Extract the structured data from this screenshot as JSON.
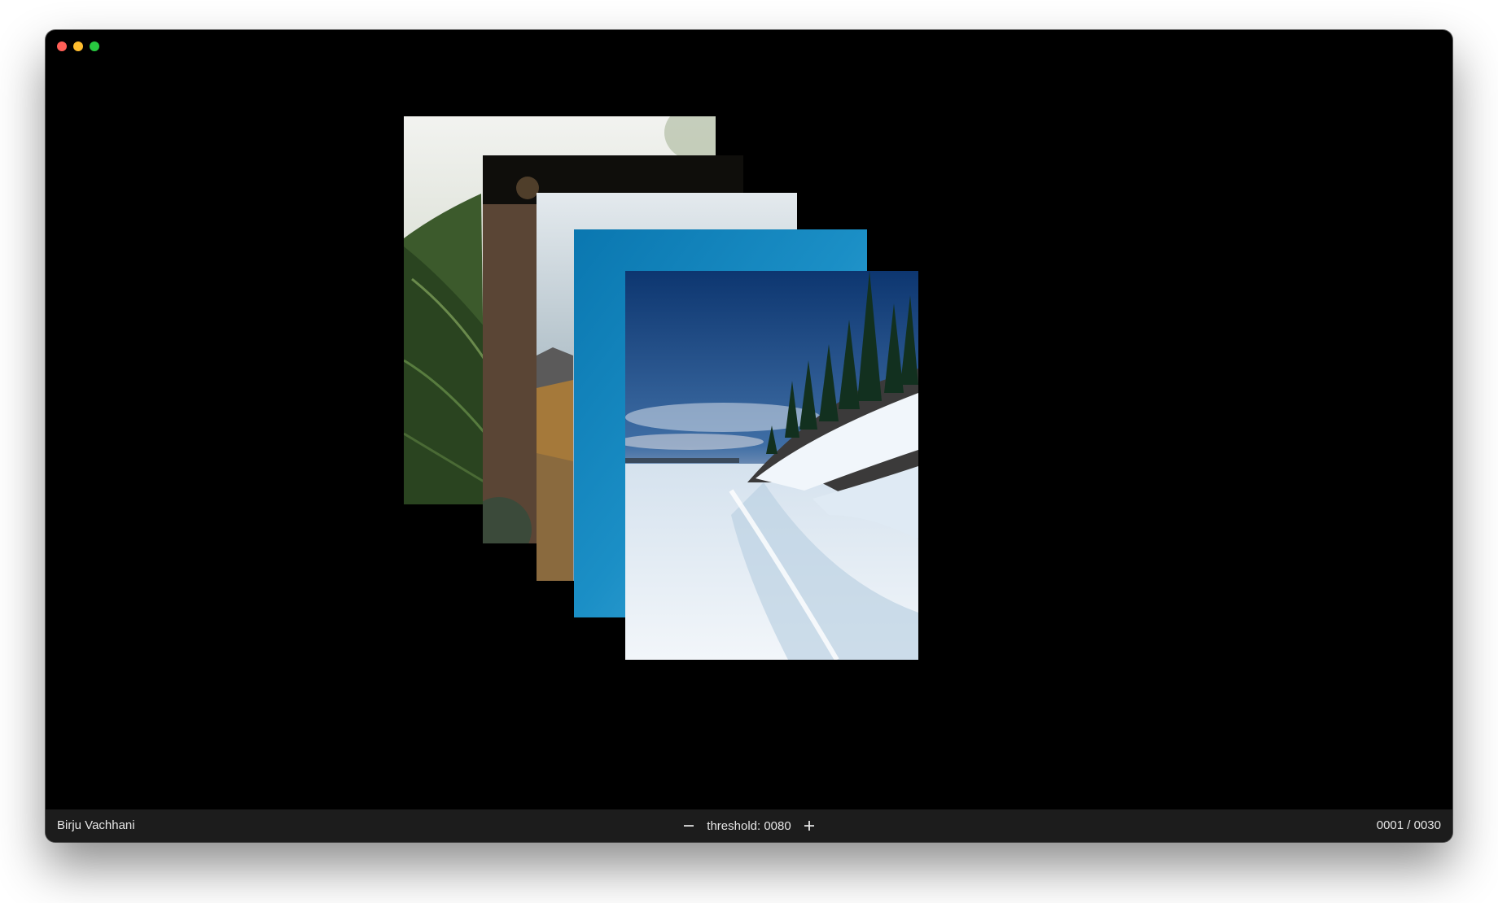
{
  "window": {
    "traffic_lights": [
      {
        "name": "close",
        "color": "#ff5f57"
      },
      {
        "name": "minimize",
        "color": "#febc2e"
      },
      {
        "name": "zoom",
        "color": "#28c840"
      }
    ]
  },
  "stack": {
    "photos": [
      {
        "subject": "fern leaves",
        "palette": [
          "#f0f1ee",
          "#6e7f5c",
          "#2f4a22"
        ]
      },
      {
        "subject": "forest trail",
        "palette": [
          "#1e1a14",
          "#5a4633",
          "#3b2d21"
        ]
      },
      {
        "subject": "mountain cliff",
        "palette": [
          "#dde4e8",
          "#9aa8b0",
          "#a37a3a"
        ]
      },
      {
        "subject": "blue gradient",
        "palette": [
          "#0e7fb6",
          "#2a9fd2",
          "#59b3da"
        ]
      },
      {
        "subject": "frozen lake shore",
        "palette": [
          "#123e78",
          "#c9d7e6",
          "#eef3f8"
        ]
      }
    ]
  },
  "statusbar": {
    "author": "Birju Vachhani",
    "threshold_label": "threshold: 0080",
    "decrement_icon": "minus-icon",
    "increment_icon": "plus-icon",
    "counter": "0001 / 0030"
  }
}
